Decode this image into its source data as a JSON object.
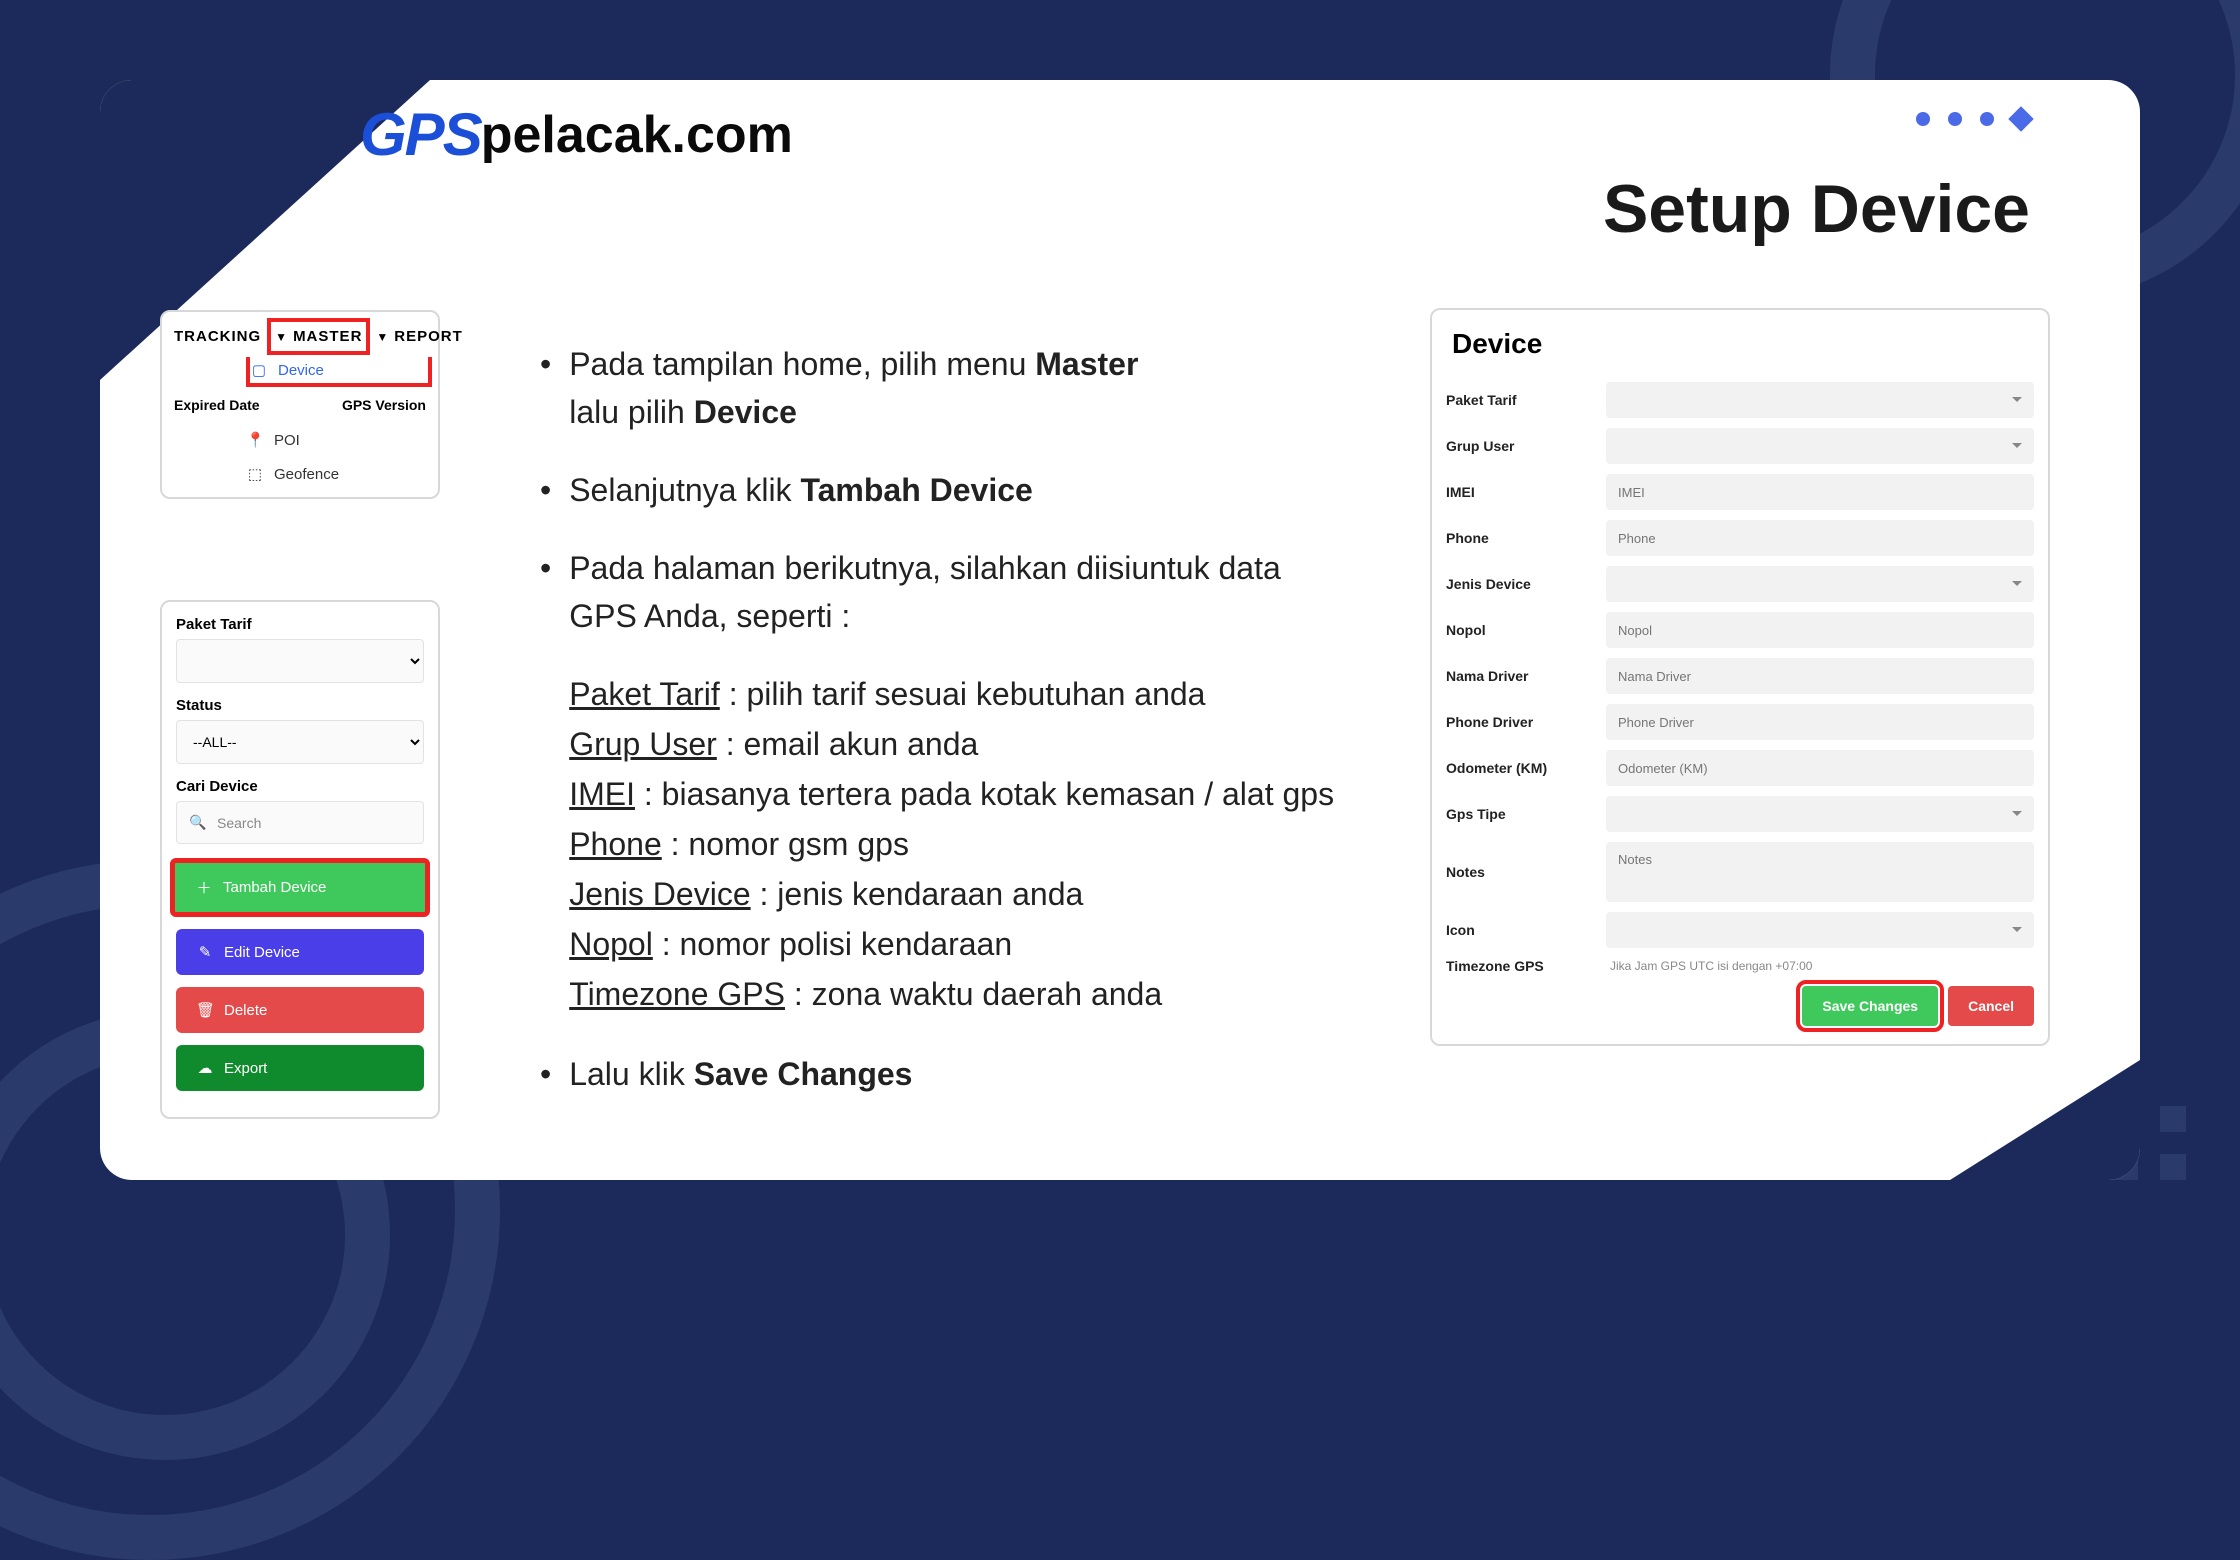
{
  "logo": {
    "gps": "GPS",
    "rest": "pelacak.com"
  },
  "title": "Setup Device",
  "menu": {
    "tabs": [
      "TRACKING",
      "MASTER",
      "REPORT"
    ],
    "items": [
      "Device",
      "POI",
      "Geofence"
    ],
    "headers": [
      "Expired Date",
      "GPS Version"
    ]
  },
  "tools": {
    "paket_label": "Paket Tarif",
    "status_label": "Status",
    "status_value": "--ALL--",
    "search_label": "Cari Device",
    "search_placeholder": "Search",
    "buttons": {
      "add": "Tambah Device",
      "edit": "Edit Device",
      "delete": "Delete",
      "export": "Export"
    }
  },
  "instr": {
    "l1a": "Pada tampilan home, pilih menu ",
    "l1b": "Master",
    "l1c": "lalu pilih ",
    "l1d": "Device",
    "l2a": "Selanjutnya klik ",
    "l2b": "Tambah Device",
    "l3a": "Pada halaman berikutnya, silahkan diisiuntuk data",
    "l3b": "GPS Anda, seperti :",
    "defs": {
      "paket": {
        "k": "Paket Tarif",
        "v": " : pilih tarif sesuai kebutuhan anda"
      },
      "grup": {
        "k": "Grup User",
        "v": " : email akun anda"
      },
      "imei": {
        "k": "IMEI",
        "v": " : biasanya tertera pada kotak kemasan / alat gps"
      },
      "phone": {
        "k": "Phone",
        "v": " : nomor gsm gps"
      },
      "jenis": {
        "k": "Jenis Device",
        "v": " : jenis kendaraan anda"
      },
      "nopol": {
        "k": "Nopol",
        "v": " : nomor polisi kendaraan"
      },
      "tz": {
        "k": "Timezone GPS",
        "v": " : zona waktu daerah anda"
      }
    },
    "l4a": "Lalu klik ",
    "l4b": "Save Changes"
  },
  "form": {
    "title": "Device",
    "fields": {
      "paket": "Paket Tarif",
      "grup": "Grup User",
      "imei": {
        "l": "IMEI",
        "p": "IMEI"
      },
      "phone": {
        "l": "Phone",
        "p": "Phone"
      },
      "jenis": "Jenis Device",
      "nopol": {
        "l": "Nopol",
        "p": "Nopol"
      },
      "driver": {
        "l": "Nama Driver",
        "p": "Nama Driver"
      },
      "pdriver": {
        "l": "Phone Driver",
        "p": "Phone Driver"
      },
      "odo": {
        "l": "Odometer (KM)",
        "p": "Odometer (KM)"
      },
      "gpstipe": "Gps Tipe",
      "notes": {
        "l": "Notes",
        "p": "Notes"
      },
      "icon": "Icon",
      "tz": {
        "l": "Timezone GPS",
        "note": "Jika Jam GPS UTC isi dengan +07:00"
      }
    },
    "save": "Save Changes",
    "cancel": "Cancel"
  }
}
